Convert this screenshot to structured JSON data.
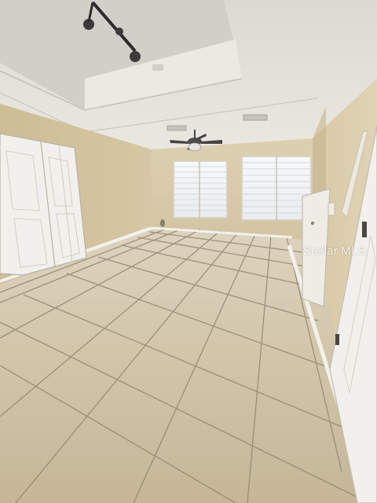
{
  "photo": {
    "watermark": "Stellar MLS",
    "scene": "empty-room-tile-floor",
    "colors": {
      "ceiling": "#e6e3dc",
      "wall": "#d9c9a6",
      "wall_shadow": "#c9b78f",
      "floor_tile": "#cfc2a6",
      "grout": "#8e826c",
      "door": "#f2f0ec",
      "window_light": "#f4f6f8",
      "baseboard": "#f3f1ec"
    },
    "icons": [
      "track-light-icon",
      "ceiling-fan-icon",
      "air-vent-icon"
    ]
  }
}
